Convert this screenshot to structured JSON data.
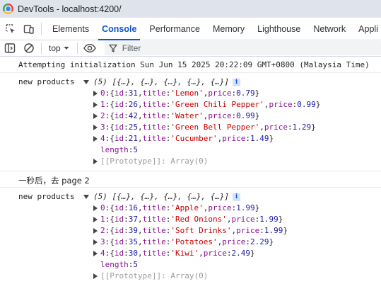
{
  "window": {
    "title": "DevTools - localhost:4200/"
  },
  "panel_tabs": [
    "Elements",
    "Console",
    "Performance",
    "Memory",
    "Lighthouse",
    "Network",
    "Appli"
  ],
  "active_tab": "Console",
  "toolbar": {
    "context": "top",
    "filter_placeholder": "Filter"
  },
  "console": {
    "init_message": "Attempting initialization Sun Jun 15 2025 20:22:09 GMT+0800 (Malaysia Time)",
    "after_message": "一秒后，去 page 2",
    "log_label": "new products",
    "array_preview": "(5) [{…}, {…}, {…}, {…}, {…}]",
    "length_label": "length",
    "length_value": "5",
    "prototype_text": "[[Prototype]]: Array(0)",
    "batch1": [
      {
        "index": "0",
        "id": "31",
        "title": "'Lemon'",
        "price": "0.79"
      },
      {
        "index": "1",
        "id": "26",
        "title": "'Green Chili Pepper'",
        "price": "0.99"
      },
      {
        "index": "2",
        "id": "42",
        "title": "'Water'",
        "price": "0.99"
      },
      {
        "index": "3",
        "id": "25",
        "title": "'Green Bell Pepper'",
        "price": "1.29"
      },
      {
        "index": "4",
        "id": "21",
        "title": "'Cucumber'",
        "price": "1.49"
      }
    ],
    "batch2": [
      {
        "index": "0",
        "id": "16",
        "title": "'Apple'",
        "price": "1.99"
      },
      {
        "index": "1",
        "id": "37",
        "title": "'Red Onions'",
        "price": "1.99"
      },
      {
        "index": "2",
        "id": "39",
        "title": "'Soft Drinks'",
        "price": "1.99"
      },
      {
        "index": "3",
        "id": "35",
        "title": "'Potatoes'",
        "price": "2.29"
      },
      {
        "index": "4",
        "id": "30",
        "title": "'Kiwi'",
        "price": "2.49"
      }
    ]
  },
  "colors": {
    "accent": "#0b57d0",
    "key": "#881391",
    "number": "#1a1aa6",
    "string": "#c80000"
  }
}
